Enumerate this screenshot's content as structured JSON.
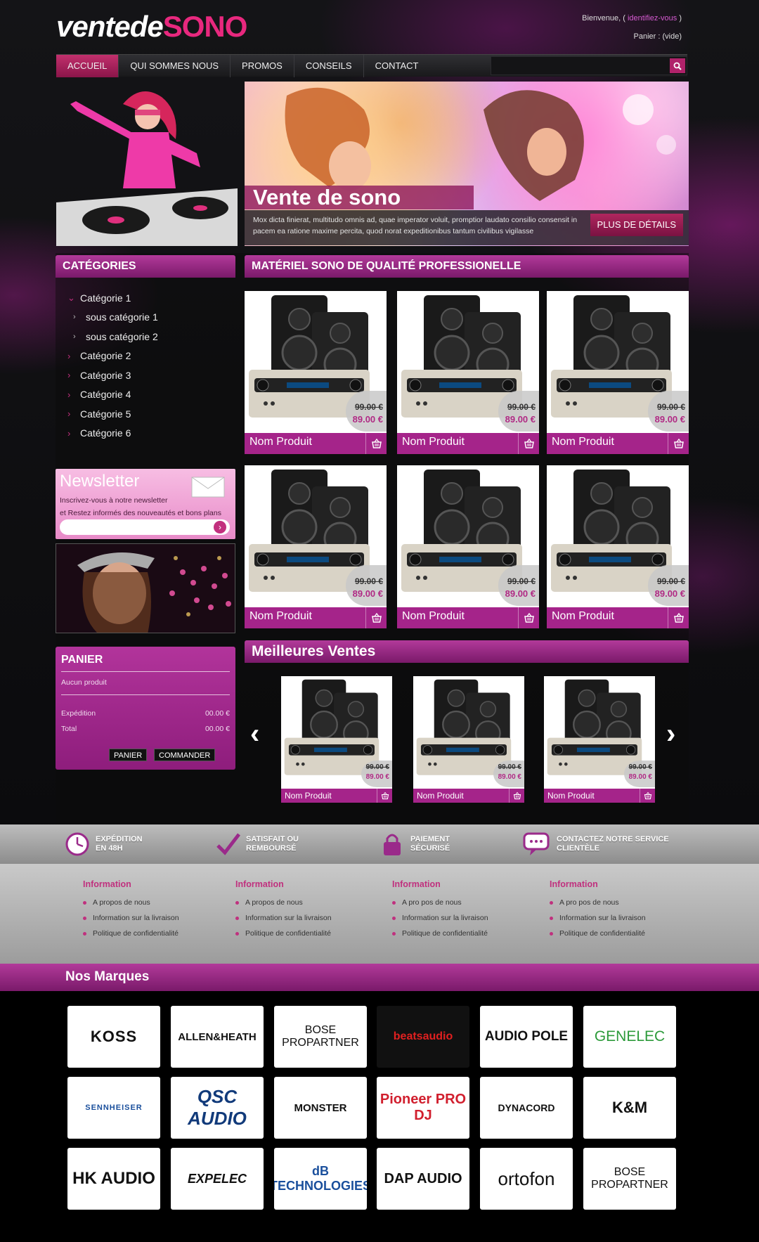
{
  "header": {
    "logo_part1": "ventede",
    "logo_part2": "SONO",
    "welcome_prefix": "Bienvenue, (",
    "welcome_link": "identifiez-vous",
    "welcome_suffix": ")",
    "cart_label": "Panier : (vide)"
  },
  "nav": {
    "items": [
      "ACCUEIL",
      "QUI SOMMES NOUS",
      "PROMOS",
      "CONSEILS",
      "CONTACT"
    ],
    "active_index": 0,
    "search_placeholder": ""
  },
  "banner": {
    "title": "Vente de sono",
    "text": "Mox dicta finierat, multitudo omnis ad, quae imperator voluit, promptior laudato consilio consensit in pacem ea ratione maxime percita, quod norat expeditionibus tantum civilibus vigilasse",
    "button": "PLUS DE DÉTAILS"
  },
  "sidebar": {
    "categories_title": "CATÉGORIES",
    "categories": [
      {
        "label": "Catégorie 1",
        "sub": false,
        "open": true
      },
      {
        "label": "sous catégorie 1",
        "sub": true
      },
      {
        "label": "sous catégorie 2",
        "sub": true
      },
      {
        "label": "Catégorie 2",
        "sub": false
      },
      {
        "label": "Catégorie 3",
        "sub": false
      },
      {
        "label": "Catégorie 4",
        "sub": false
      },
      {
        "label": "Catégorie 5",
        "sub": false
      },
      {
        "label": "Catégorie 6",
        "sub": false
      }
    ],
    "newsletter": {
      "title": "Newsletter",
      "line1": "Inscrivez-vous à notre newsletter",
      "line2": "et Restez informés des nouveautés et bons plans"
    },
    "panier": {
      "title": "PANIER",
      "empty": "Aucun produit",
      "shipping_label": "Expédition",
      "shipping_value": "00.00 €",
      "total_label": "Total",
      "total_value": "00.00 €",
      "btn_cart": "PANIER",
      "btn_order": "COMMANDER"
    }
  },
  "main": {
    "section_title": "MATÉRIEL SONO DE QUALITÉ PROFESSIONELLE",
    "products": [
      {
        "name": "Nom Produit",
        "old_price": "99.00 €",
        "price": "89.00 €"
      },
      {
        "name": "Nom Produit",
        "old_price": "99.00 €",
        "price": "89.00 €"
      },
      {
        "name": "Nom Produit",
        "old_price": "99.00 €",
        "price": "89.00 €"
      },
      {
        "name": "Nom Produit",
        "old_price": "99.00 €",
        "price": "89.00 €"
      },
      {
        "name": "Nom Produit",
        "old_price": "99.00 €",
        "price": "89.00 €"
      },
      {
        "name": "Nom Produit",
        "old_price": "99.00 €",
        "price": "89.00 €"
      }
    ],
    "best_title": "Meilleures Ventes",
    "best": [
      {
        "name": "Nom Produit",
        "old_price": "99.00 €",
        "price": "89.00 €"
      },
      {
        "name": "Nom Produit",
        "old_price": "99.00 €",
        "price": "89.00 €"
      },
      {
        "name": "Nom Produit",
        "old_price": "99.00 €",
        "price": "89.00 €"
      }
    ]
  },
  "features": [
    {
      "line1": "EXPÉDITION",
      "line2": "EN 48H",
      "icon": "clock-icon"
    },
    {
      "line1": "SATISFAIT OU",
      "line2": "REMBOURSÉ",
      "icon": "check-icon"
    },
    {
      "line1": "PAIEMENT",
      "line2": "SÉCURISÉ",
      "icon": "lock-icon"
    },
    {
      "line1": "CONTACTEZ NOTRE SERVICE",
      "line2": "CLIENTÈLE",
      "icon": "chat-icon"
    }
  ],
  "info_columns": [
    {
      "title": "Information",
      "links": [
        "A propos de nous",
        "Information sur la livraison",
        "Politique de confidentialité"
      ]
    },
    {
      "title": "Information",
      "links": [
        "A propos de nous",
        "Information sur la livraison",
        "Politique de confidentialité"
      ]
    },
    {
      "title": "Information",
      "links": [
        "A pro pos de nous",
        "Information sur la livraison",
        "Politique de confidentialité"
      ]
    },
    {
      "title": "Information",
      "links": [
        "A pro pos de nous",
        "Information sur la livraison",
        "Politique de confidentialité"
      ]
    }
  ],
  "brands_title": "Nos Marques",
  "brands": [
    "KOSS",
    "ALLEN&HEATH",
    "BOSE PROPARTNER",
    "beatsaudio",
    "AUDIO POLE",
    "GENELEC",
    "SENNHEISER",
    "QSC AUDIO",
    "MONSTER",
    "Pioneer PRO DJ",
    "DYNACORD",
    "K&M",
    "HK AUDIO",
    "EXPELEC",
    "dB TECHNOLOGIES",
    "DAP AUDIO",
    "ortofon",
    "BOSE PROPARTNER"
  ],
  "colors": {
    "accent": "#a5248a",
    "nav_active": "#c2306d",
    "logo_pink": "#e8287e"
  }
}
